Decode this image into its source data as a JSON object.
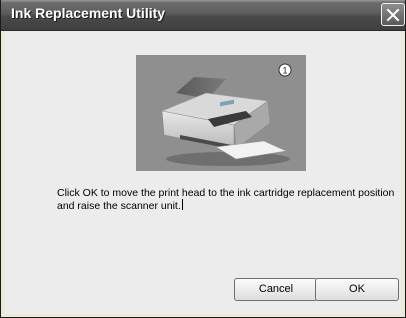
{
  "window": {
    "title": "Ink Replacement Utility",
    "close_label": "close-icon"
  },
  "illustration": {
    "subject": "printer-illustration",
    "step_number": "1"
  },
  "message": {
    "line1": "Click OK to move the print head to the ink cartridge replacement position",
    "line2": "and raise the scanner unit."
  },
  "buttons": {
    "cancel_label": "Cancel",
    "ok_label": "OK"
  },
  "colors": {
    "titlebar": "#5c5c5c",
    "client_background": "#ececec",
    "illustration_background": "#8f8f8f"
  }
}
